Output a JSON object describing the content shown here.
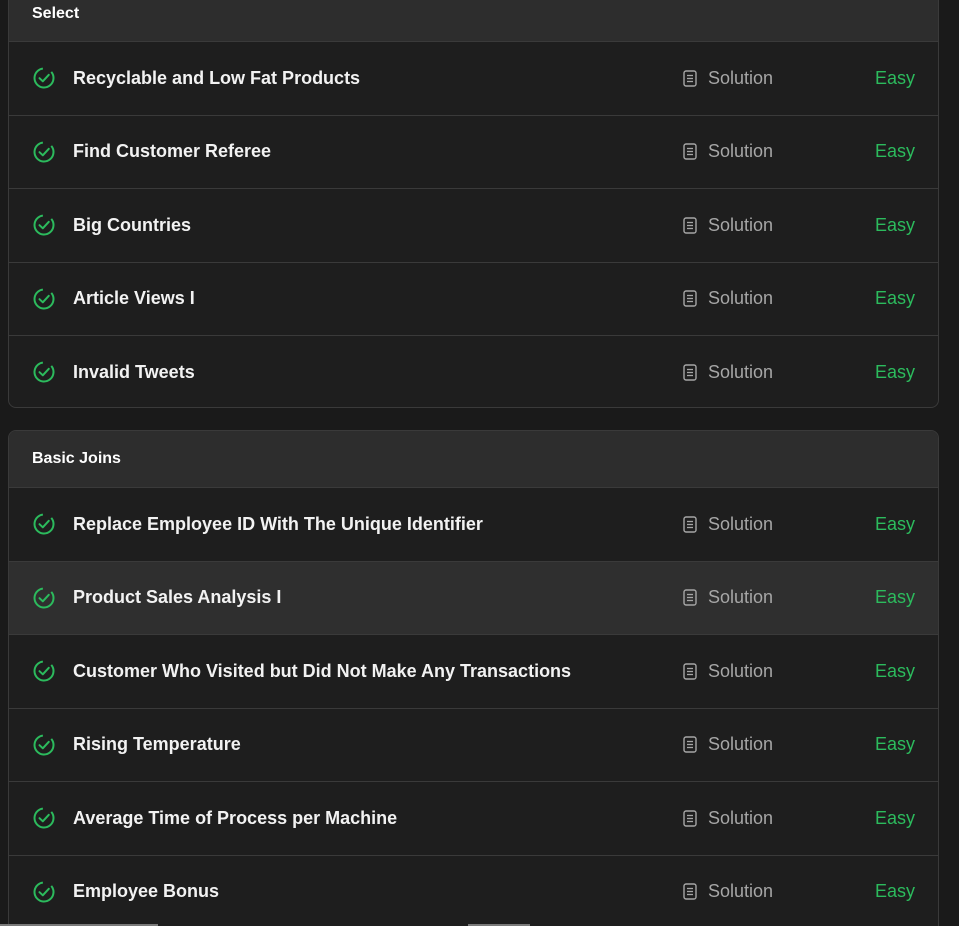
{
  "colors": {
    "background": "#1a1a1a",
    "section_background": "#1e1e1e",
    "header_background": "#2d2d2d",
    "accent_easy": "#2cbb5d",
    "check_green": "#2cbb5d"
  },
  "sections": [
    {
      "title": "Select",
      "items": [
        {
          "title": "Recyclable and Low Fat Products",
          "solution": "Solution",
          "difficulty": "Easy",
          "status_icon": "check-circle-icon"
        },
        {
          "title": "Find Customer Referee",
          "solution": "Solution",
          "difficulty": "Easy",
          "status_icon": "check-circle-icon"
        },
        {
          "title": "Big Countries",
          "solution": "Solution",
          "difficulty": "Easy",
          "status_icon": "check-circle-icon"
        },
        {
          "title": "Article Views I",
          "solution": "Solution",
          "difficulty": "Easy",
          "status_icon": "check-circle-icon"
        },
        {
          "title": "Invalid Tweets",
          "solution": "Solution",
          "difficulty": "Easy",
          "status_icon": "check-circle-icon"
        }
      ]
    },
    {
      "title": "Basic Joins",
      "items": [
        {
          "title": "Replace Employee ID With The Unique Identifier",
          "solution": "Solution",
          "difficulty": "Easy",
          "status_icon": "check-circle-icon"
        },
        {
          "title": "Product Sales Analysis I",
          "solution": "Solution",
          "difficulty": "Easy",
          "status_icon": "check-circle-icon"
        },
        {
          "title": "Customer Who Visited but Did Not Make Any Transactions",
          "solution": "Solution",
          "difficulty": "Easy",
          "status_icon": "check-circle-icon"
        },
        {
          "title": "Rising Temperature",
          "solution": "Solution",
          "difficulty": "Easy",
          "status_icon": "check-circle-icon"
        },
        {
          "title": "Average Time of Process per Machine",
          "solution": "Solution",
          "difficulty": "Easy",
          "status_icon": "check-circle-icon"
        },
        {
          "title": "Employee Bonus",
          "solution": "Solution",
          "difficulty": "Easy",
          "status_icon": "check-circle-icon"
        }
      ]
    }
  ]
}
